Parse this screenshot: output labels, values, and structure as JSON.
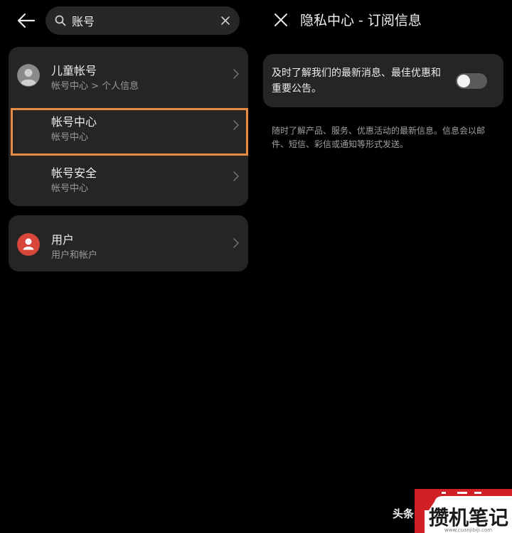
{
  "search": {
    "query": "账号"
  },
  "results": {
    "group1": [
      {
        "title": "儿童帐号",
        "subtitle": "帐号中心 > 个人信息",
        "avatar": "person-gray-icon"
      },
      {
        "title": "帐号中心",
        "subtitle": "帐号中心"
      },
      {
        "title": "帐号安全",
        "subtitle": "帐号中心"
      }
    ],
    "group2": [
      {
        "title": "用户",
        "subtitle": "用户和帐户",
        "avatar": "person-red-icon"
      }
    ]
  },
  "detail": {
    "title": "隐私中心 - 订阅信息",
    "toggle_label": "及时了解我们的最新消息、最佳优惠和重要公告。",
    "toggle_on": false,
    "description": "随时了解产品、服务、优惠活动的最新信息。信息会以邮件、短信、彩信或通知等形式发送。"
  },
  "watermark": {
    "partial": "头条",
    "brand": "攒机笔记",
    "url": "www.cuanjibiji.com"
  },
  "colors": {
    "highlight": "#e88a42",
    "avatar_red": "#d9463c",
    "avatar_gray": "#8a8a8a"
  }
}
